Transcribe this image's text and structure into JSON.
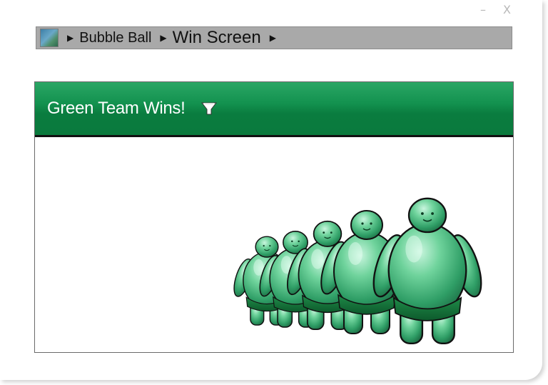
{
  "window": {
    "controls": {
      "minimize_glyph": "–",
      "close_glyph": "X"
    }
  },
  "breadcrumb": {
    "icon": "game-thumbnail-icon",
    "items": [
      {
        "label": "Bubble Ball"
      },
      {
        "label": "Win Screen"
      }
    ]
  },
  "panel": {
    "title": "Green Team Wins!",
    "dropdown_icon": "chevron-down-icon",
    "header_color": "#0a7c3f",
    "illustration": "row of green gel mascot figures"
  }
}
